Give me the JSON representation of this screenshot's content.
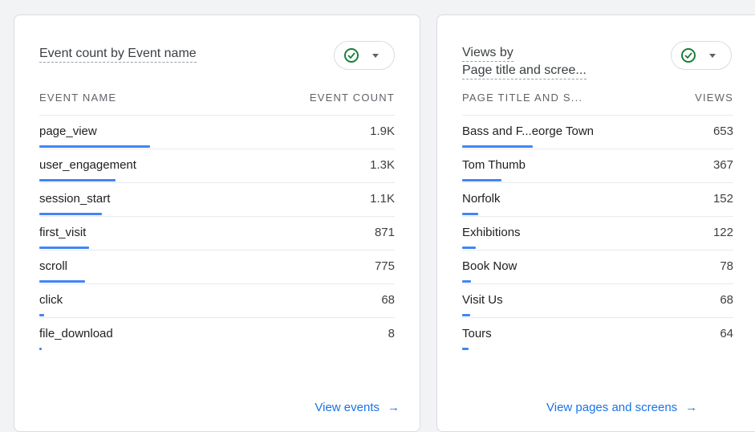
{
  "events_card": {
    "title": "Event count by Event name",
    "col_left": "EVENT NAME",
    "col_right": "EVENT COUNT",
    "rows": [
      {
        "label": "page_view",
        "value": "1.9K",
        "fraction": 0.73
      },
      {
        "label": "user_engagement",
        "value": "1.3K",
        "fraction": 0.5
      },
      {
        "label": "session_start",
        "value": "1.1K",
        "fraction": 0.41
      },
      {
        "label": "first_visit",
        "value": "871",
        "fraction": 0.33
      },
      {
        "label": "scroll",
        "value": "775",
        "fraction": 0.3
      },
      {
        "label": "click",
        "value": "68",
        "fraction": 0.03
      },
      {
        "label": "file_download",
        "value": "8",
        "fraction": 0.005
      }
    ],
    "link": "View events",
    "link_arrow": "→"
  },
  "views_card": {
    "title_line1": "Views by",
    "title_line2": "Page title and scree...",
    "col_left": "PAGE TITLE AND S...",
    "col_right": "VIEWS",
    "rows": [
      {
        "label": "Bass and F...eorge Town",
        "value": "653",
        "fraction": 0.73
      },
      {
        "label": "Tom Thumb",
        "value": "367",
        "fraction": 0.41
      },
      {
        "label": "Norfolk",
        "value": "152",
        "fraction": 0.17
      },
      {
        "label": "Exhibitions",
        "value": "122",
        "fraction": 0.14
      },
      {
        "label": "Book Now",
        "value": "78",
        "fraction": 0.09
      },
      {
        "label": "Visit Us",
        "value": "68",
        "fraction": 0.08
      },
      {
        "label": "Tours",
        "value": "64",
        "fraction": 0.07
      }
    ],
    "link": "View pages and screens",
    "link_arrow": "→"
  },
  "compare_icon": "check-circle-icon",
  "colors": {
    "bar": "#4285f4",
    "link": "#1a73e8",
    "check": "#188038"
  }
}
